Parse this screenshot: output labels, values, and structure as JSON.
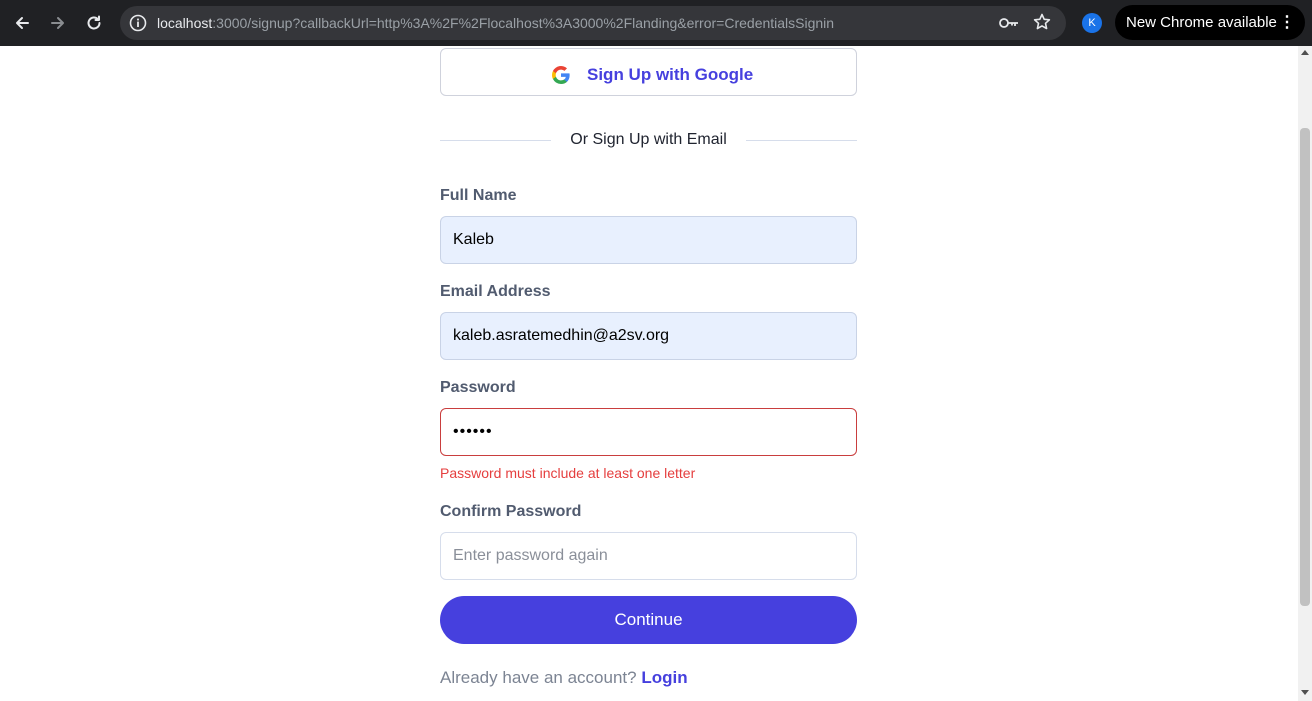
{
  "browser": {
    "url_host": "localhost",
    "url_rest": ":3000/signup?callbackUrl=http%3A%2F%2Flocalhost%3A3000%2Flanding&error=CredentialsSignin",
    "profile_initial": "K",
    "update_label": "New Chrome available",
    "menu_glyph": "⋮"
  },
  "signup": {
    "google_button_label": "Sign Up with Google",
    "divider_text": "Or Sign Up with Email",
    "fields": [
      {
        "label": "Full Name",
        "value": "Kaleb",
        "placeholder": ""
      },
      {
        "label": "Email Address",
        "value": "kaleb.asratemedhin@a2sv.org",
        "placeholder": ""
      },
      {
        "label": "Password",
        "value": "••••••",
        "placeholder": ""
      },
      {
        "label": "Confirm Password",
        "value": "",
        "placeholder": "Enter password again"
      }
    ],
    "password_error": "Password must include at least one letter",
    "continue_label": "Continue",
    "account_prompt": "Already have an account?",
    "login_label": "Login"
  },
  "colors": {
    "accent": "#4640de",
    "error": "#e53e3e",
    "autofill_bg": "#e8f0fe"
  }
}
